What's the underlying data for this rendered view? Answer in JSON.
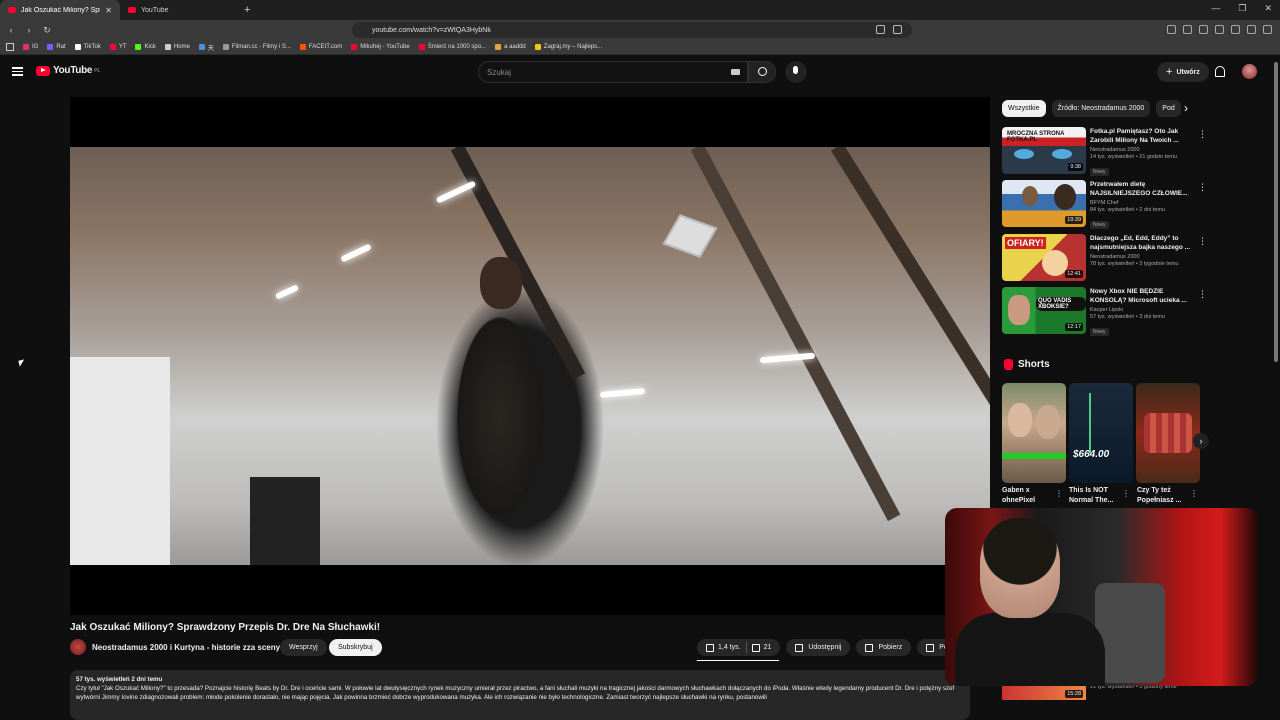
{
  "browser": {
    "tabs": [
      {
        "title": "Jak Oszukać Miliony? Sprawd",
        "active": true
      },
      {
        "title": "YouTube",
        "active": false
      }
    ],
    "new_tab": "+",
    "url": "youtube.com/watch?v=zWtQA3HybNk",
    "bookmarks": [
      {
        "label": "IG",
        "color": "#e1306c"
      },
      {
        "label": "Rat",
        "color": "#7b5cff"
      },
      {
        "label": "TikTok",
        "color": "#ffffff"
      },
      {
        "label": "YT",
        "color": "#ff0033"
      },
      {
        "label": "Kick",
        "color": "#53fc18"
      },
      {
        "label": "Home",
        "color": "#cccccc"
      },
      {
        "label": "天",
        "color": "#4a90d9"
      },
      {
        "label": "Filman.cc - Filmy i S...",
        "color": "#999999"
      },
      {
        "label": "FACEIT.com",
        "color": "#ff5500"
      },
      {
        "label": "Mikuhej - YouTube",
        "color": "#ff0033"
      },
      {
        "label": "Śmierć na 1000 spo...",
        "color": "#ff0033"
      },
      {
        "label": "a aaddd",
        "color": "#e8a33c"
      },
      {
        "label": "Zagraj.my – Najleps...",
        "color": "#f5c518"
      }
    ]
  },
  "header": {
    "logo_text": "YouTube",
    "logo_region": "PL",
    "search_placeholder": "Szukaj",
    "create_label": "Utwórz"
  },
  "video": {
    "title": "Jak Oszukać Miliony? Sprawdzony Przepis Dr. Dre Na Słuchawki!",
    "channel": "Neostradamus 2000 i Kurtyna - historie zza sceny",
    "support_label": "Wesprzyj",
    "subscribe_label": "Subskrybuj",
    "likes": "1,4 tys.",
    "dislikes": "21",
    "share_label": "Udostępnij",
    "download_label": "Pobierz",
    "thanks_label": "Podz",
    "meta": "57 tys. wyświetleń  2 dni temu",
    "description": "Czy tytuł \"Jak Oszukać Miliony?\" to przesada? Poznajcie historię Beats by Dr. Dre i oceńcie sami. W połowie lat dwutysięcznych rynek muzyczny umierał przez piractwo, a fani słuchali muzyki na tragicznej jakości darmowych słuchawkach dołączanych do iPoda. Właśnie wtedy legendarny producent Dr. Dre i potężny szef wytwórni Jimmy Iovine zdiagnozowali problem: młode pokolenie dorastało, nie mając pojęcia. Jak powinna brzmieć dobrze wyprodukowana muzyka. Ale ich rozwiązanie nie było technologiczne. Zamiast tworzyć najlepsze słuchawki na rynku, postanowili"
  },
  "sidebar": {
    "chips": [
      {
        "label": "Wszystkie",
        "active": true
      },
      {
        "label": "Źródło: Neostradamus 2000",
        "active": false
      },
      {
        "label": "Pod",
        "active": false
      }
    ],
    "recommendations": [
      {
        "title": "Fotka.pl Pamiętasz? Oto Jak Zarobili Miliony Na Twoich ...",
        "channel": "Neostradamus 2000",
        "views": "14 tys. wyświetleń • 21 godzin temu",
        "badge": "Nowy",
        "duration": "9:38",
        "thumb_text": "MROCZNA STRONA FOTKA.PL"
      },
      {
        "title": "Przetrwałem dietę NAJSILNIEJSZEGO CZŁOWIE...",
        "channel": "BFYM Chef",
        "views": "84 tys. wyświetleń • 2 dni temu",
        "badge": "Nowy",
        "duration": "19:39",
        "thumb_text": ""
      },
      {
        "title": "Dlaczego „Ed, Edd, Eddy” to najsmutniejsza bajka naszego ...",
        "channel": "Neostradamus 2000",
        "views": "78 tys. wyświetleń • 3 tygodnie temu",
        "badge": "",
        "duration": "12:41",
        "thumb_text": "OFIARY!"
      },
      {
        "title": "Nowy Xbox NIE BĘDZIE KONSOLĄ? Microsoft ucieka ...",
        "channel": "Kacper Lipski",
        "views": "57 tys. wyświetleń • 3 dni temu",
        "badge": "Nowy",
        "duration": "12:17",
        "thumb_text": "QUO VADIS XBOKSIE?"
      }
    ],
    "shorts_heading": "Shorts",
    "shorts": [
      {
        "title": "Gaben x ohnePixel"
      },
      {
        "title": "This Is NOT Normal The..."
      },
      {
        "title": "Czy Ty też Popełniasz ..."
      }
    ],
    "shorts_price": "$664.00",
    "bottom_rec": {
      "views": "21 tys. wyświetleń • 3 godziny temu",
      "duration": "15:28"
    }
  }
}
